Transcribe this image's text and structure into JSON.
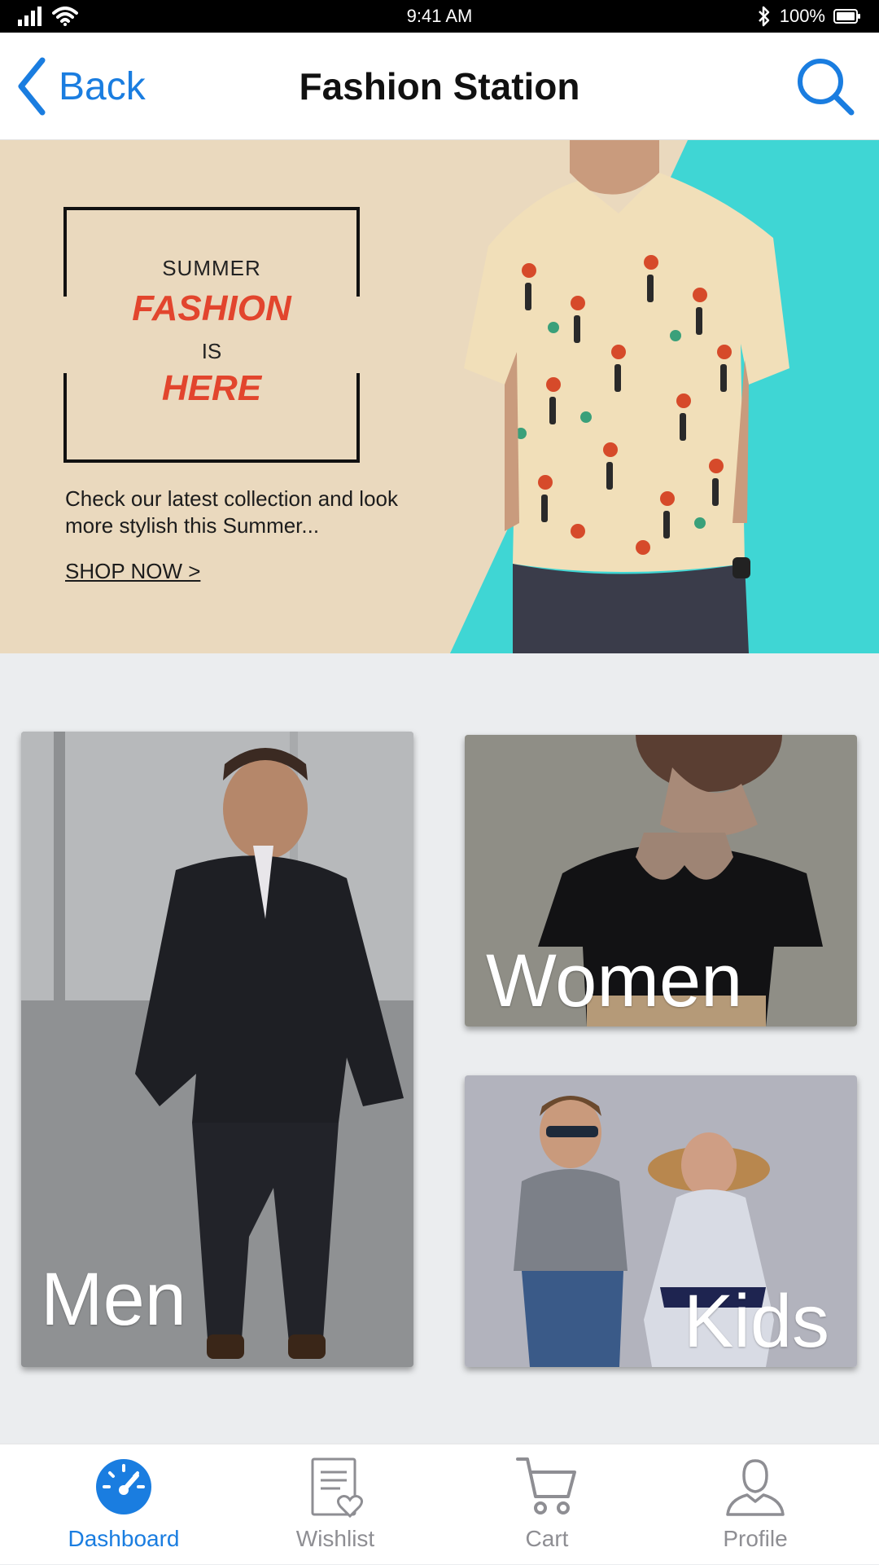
{
  "status_bar": {
    "time": "9:41 AM",
    "battery": "100%"
  },
  "nav": {
    "back_label": "Back",
    "title": "Fashion Station"
  },
  "banner": {
    "line1": "SUMMER",
    "line2": "FASHION",
    "line3": "IS",
    "line4": "HERE",
    "description": "Check our latest collection and look more stylish this Summer...",
    "cta": "SHOP NOW >"
  },
  "categories": [
    {
      "label": "Men"
    },
    {
      "label": "Women"
    },
    {
      "label": "Kids"
    }
  ],
  "tabs": [
    {
      "label": "Dashboard",
      "icon": "dashboard-icon",
      "active": true
    },
    {
      "label": "Wishlist",
      "icon": "wishlist-icon",
      "active": false
    },
    {
      "label": "Cart",
      "icon": "cart-icon",
      "active": false
    },
    {
      "label": "Profile",
      "icon": "profile-icon",
      "active": false
    }
  ],
  "colors": {
    "accent": "#1a7de0",
    "promo_red": "#e2452d",
    "banner_bg": "#ead9be",
    "banner_teal": "#3fd6d4",
    "page_bg": "#ebedef"
  }
}
